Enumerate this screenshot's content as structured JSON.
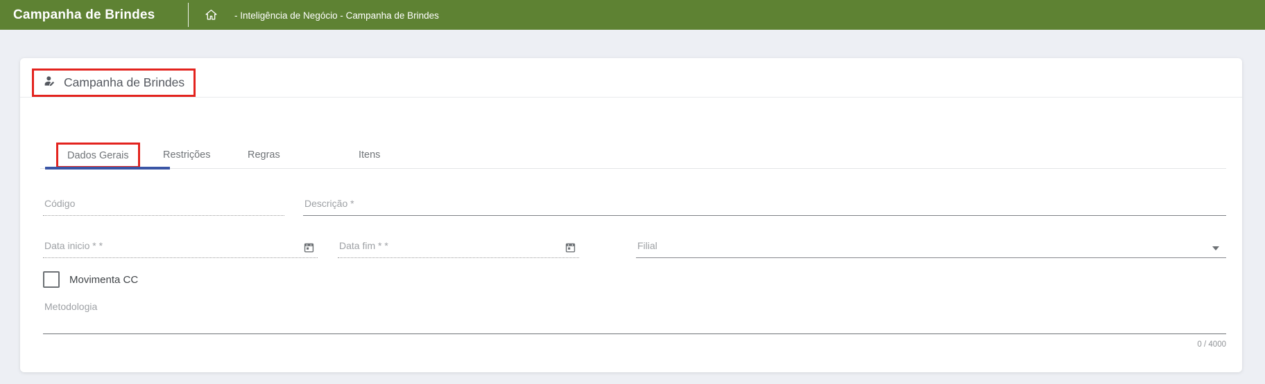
{
  "header": {
    "title": "Campanha de Brindes",
    "breadcrumb": "- Inteligência de Negócio - Campanha de Brindes"
  },
  "card": {
    "title": "Campanha de Brindes",
    "tabs": [
      {
        "label": "Dados Gerais",
        "active": true,
        "annotated": true
      },
      {
        "label": "Restrições",
        "active": false
      },
      {
        "label": "Regras",
        "active": false
      },
      {
        "label": "Itens",
        "active": false
      }
    ],
    "form": {
      "codigo_label": "Código",
      "codigo_value": "",
      "descricao_label": "Descrição *",
      "descricao_value": "",
      "data_inicio_label": "Data inicio * *",
      "data_inicio_value": "",
      "data_fim_label": "Data fim * *",
      "data_fim_value": "",
      "filial_label": "Filial",
      "filial_value": "",
      "movimenta_cc_label": "Movimenta CC",
      "movimenta_cc_checked": false,
      "metodologia_label": "Metodologia",
      "metodologia_value": "",
      "metodologia_counter": "0 / 4000"
    }
  },
  "icons": {
    "home": "house-outline",
    "card_title": "user-edit",
    "date_fields": "calendar",
    "filial": "caret-down"
  },
  "colors": {
    "header_green": "#5E8233",
    "active_tab_underline": "#3A55A5",
    "annotation_red": "#E3231E",
    "page_background": "#EDEFF4"
  }
}
